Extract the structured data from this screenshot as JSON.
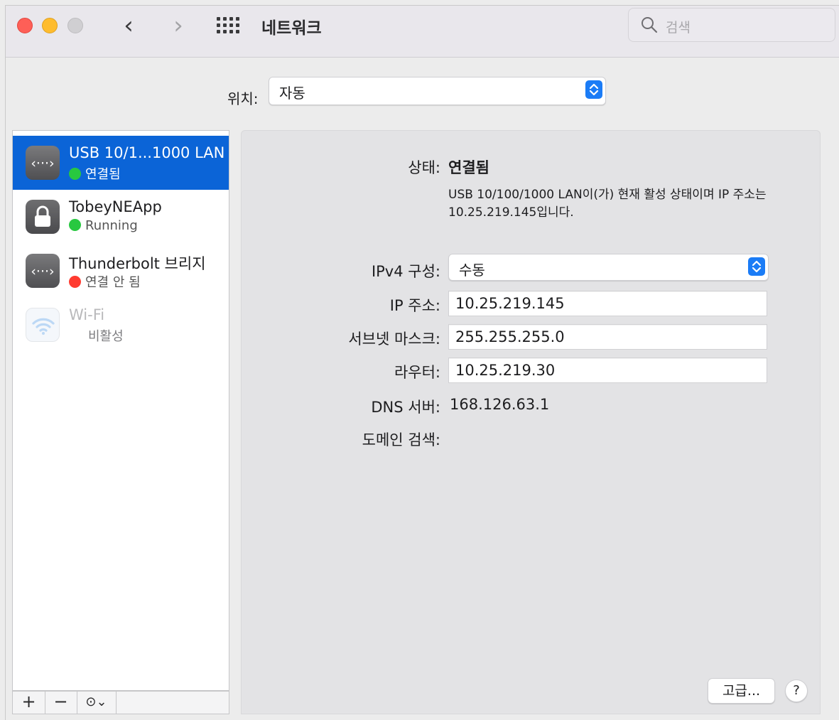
{
  "window": {
    "title": "네트워크",
    "back_glyph": "‹",
    "forward_glyph": "›",
    "search_placeholder": "검색"
  },
  "location": {
    "label": "위치:",
    "value": "자동"
  },
  "services": [
    {
      "name": "USB 10/1...1000 LAN",
      "status": "연결됨",
      "status_color": "#28c840",
      "icon": "ethernet-icon",
      "selected": true
    },
    {
      "name": "TobeyNEApp",
      "status": "Running",
      "status_color": "#28c840",
      "icon": "lock-icon",
      "selected": false
    },
    {
      "name": "Thunderbolt 브리지",
      "status": "연결 안 됨",
      "status_color": "#ff3b30",
      "icon": "ethernet-icon",
      "selected": false
    },
    {
      "name": "Wi-Fi",
      "status": "비활성",
      "status_color": "",
      "icon": "wifi-icon",
      "selected": false
    }
  ],
  "sidebar_buttons": {
    "add": "+",
    "remove": "−",
    "action": "⊙⌄"
  },
  "detail": {
    "status_label": "상태:",
    "status_value": "연결됨",
    "status_description": "USB 10/100/1000 LAN이(가) 현재 활성 상태이며 IP 주소는 10.25.219.145입니다.",
    "ipv4_label": "IPv4 구성:",
    "ipv4_value": "수동",
    "ip_label": "IP 주소:",
    "ip_value": "10.25.219.145",
    "subnet_label": "서브넷 마스크:",
    "subnet_value": "255.255.255.0",
    "router_label": "라우터:",
    "router_value": "10.25.219.30",
    "dns_label": "DNS 서버:",
    "dns_value": "168.126.63.1",
    "domain_label": "도메인 검색:",
    "domain_value": "",
    "advanced_button": "고급...",
    "help_button": "?"
  },
  "colors": {
    "selection": "#0b64d7",
    "accent": "#1b7cf6"
  }
}
